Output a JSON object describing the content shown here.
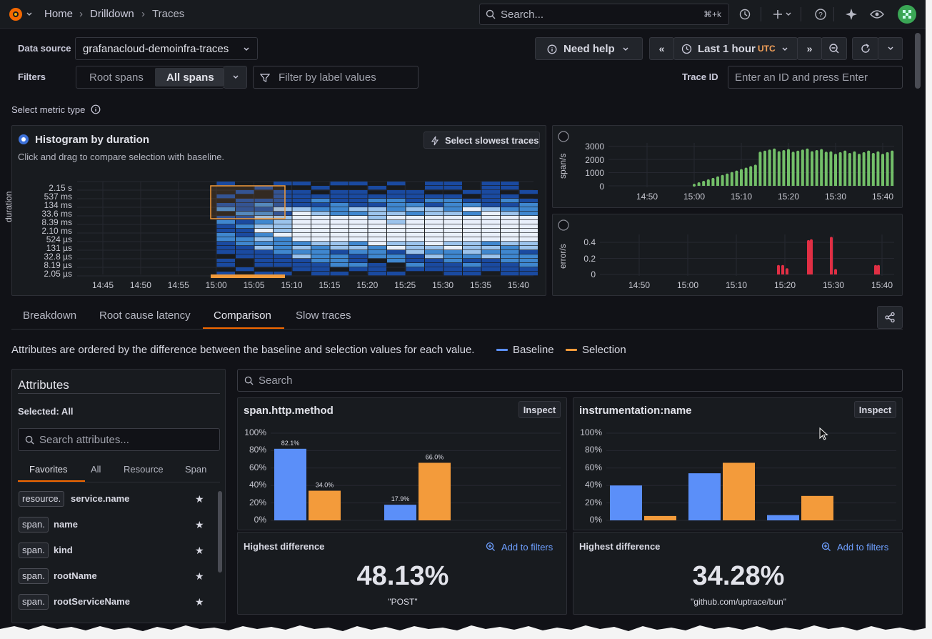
{
  "nav": {
    "home": "Home",
    "drilldown": "Drilldown",
    "traces": "Traces",
    "sep": "›",
    "search_placeholder": "Search...",
    "shortcut": "⌘+k"
  },
  "controls": {
    "data_source_label": "Data source",
    "data_source_value": "grafanacloud-demoinfra-traces",
    "filters_label": "Filters",
    "root_spans": "Root spans",
    "all_spans": "All spans",
    "filter_placeholder": "Filter by label values",
    "need_help": "Need help",
    "time_range": "Last 1 hour",
    "timezone": "UTC",
    "trace_id_label": "Trace ID",
    "trace_id_placeholder": "Enter an ID and press Enter"
  },
  "metric": {
    "select_label": "Select metric type",
    "histogram_title": "Histogram by duration",
    "histogram_hint": "Click and drag to compare selection with baseline.",
    "slowest_button": "Select slowest traces",
    "duration_axis": "duration",
    "y_ticks": [
      "2.15 s",
      "537 ms",
      "134 ms",
      "33.6 ms",
      "8.39 ms",
      "2.10 ms",
      "524 µs",
      "131 µs",
      "32.8 µs",
      "8.19 µs",
      "2.05 µs"
    ],
    "x_ticks": [
      "14:45",
      "14:50",
      "14:55",
      "15:00",
      "15:05",
      "15:10",
      "15:15",
      "15:20",
      "15:25",
      "15:30",
      "15:35",
      "15:40"
    ]
  },
  "rate": {
    "axis": "span/s",
    "y_ticks": [
      "3000",
      "2000",
      "1000",
      "0"
    ],
    "x_ticks": [
      "14:50",
      "15:00",
      "15:10",
      "15:20",
      "15:30",
      "15:40"
    ]
  },
  "errors": {
    "axis": "error/s",
    "y_ticks": [
      "0.4",
      "0.2",
      "0"
    ],
    "x_ticks": [
      "14:50",
      "15:00",
      "15:10",
      "15:20",
      "15:30",
      "15:40"
    ]
  },
  "tabs": [
    "Breakdown",
    "Root cause latency",
    "Comparison",
    "Slow traces"
  ],
  "comparison": {
    "description": "Attributes are ordered by the difference between the baseline and selection values for each value.",
    "baseline": "Baseline",
    "selection": "Selection",
    "search_placeholder": "Search"
  },
  "attributes": {
    "title": "Attributes",
    "selected": "Selected: All",
    "search_placeholder": "Search attributes...",
    "tabs": [
      "Favorites",
      "All",
      "Resource",
      "Span"
    ],
    "items": [
      {
        "prefix": "resource.",
        "name": "service.name"
      },
      {
        "prefix": "span.",
        "name": "name"
      },
      {
        "prefix": "span.",
        "name": "kind"
      },
      {
        "prefix": "span.",
        "name": "rootName"
      },
      {
        "prefix": "span.",
        "name": "rootServiceName"
      }
    ]
  },
  "cards": [
    {
      "title": "span.http.method",
      "inspect": "Inspect",
      "highest_label": "Highest difference",
      "add_filters": "Add to filters",
      "highest_value": "48.13%",
      "highest_name": "\"POST\""
    },
    {
      "title": "instrumentation:name",
      "inspect": "Inspect",
      "highest_label": "Highest difference",
      "add_filters": "Add to filters",
      "highest_value": "34.28%",
      "highest_name": "\"github.com/uptrace/bun\""
    }
  ],
  "y_percent_ticks": [
    "100%",
    "80%",
    "60%",
    "40%",
    "20%",
    "0%"
  ],
  "chart_data": [
    {
      "type": "bar",
      "title": "span.http.method",
      "series": [
        {
          "name": "Baseline",
          "values": [
            82.1,
            17.9
          ],
          "labels": [
            "82.1%",
            "17.9%"
          ]
        },
        {
          "name": "Selection",
          "values": [
            34.0,
            66.0
          ],
          "labels": [
            "34.0%",
            "66.0%"
          ]
        }
      ],
      "ylim": [
        0,
        100
      ]
    },
    {
      "type": "bar",
      "title": "instrumentation:name",
      "series": [
        {
          "name": "Baseline",
          "values": [
            40,
            54,
            6
          ]
        },
        {
          "name": "Selection",
          "values": [
            5,
            66,
            28
          ]
        }
      ],
      "ylim": [
        0,
        100
      ]
    }
  ],
  "colors": {
    "baseline": "#5b8ff9",
    "selection": "#f39b3b",
    "rate": "#73bf69",
    "error": "#e02f44",
    "accent": "#f46800"
  }
}
